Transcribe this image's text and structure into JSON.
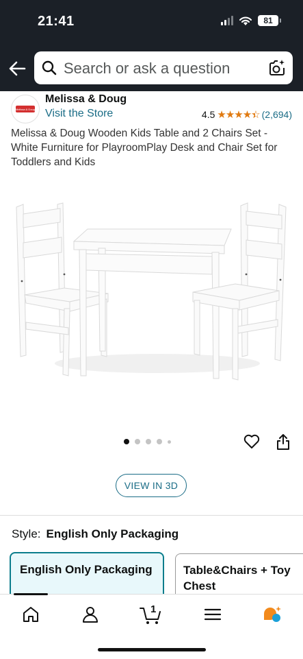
{
  "status_bar": {
    "time": "21:41",
    "battery": "81"
  },
  "search": {
    "placeholder": "Search or ask a question"
  },
  "brand": {
    "name": "Melissa & Doug",
    "visit_store": "Visit the Store",
    "logo_text": "Melissa & Doug"
  },
  "rating": {
    "value": "4.5",
    "stars": "★★★★★",
    "count": "(2,694)"
  },
  "product": {
    "title": "Melissa & Doug Wooden Kids Table and 2 Chairs Set - White Furniture for PlayroomPlay Desk and Chair Set for Toddlers and Kids",
    "image_count": 5,
    "active_image": 1
  },
  "view3d": {
    "label": "VIEW IN 3D"
  },
  "style": {
    "label": "Style:",
    "selected": "English Only Packaging",
    "options": [
      "English Only Packaging",
      "Table&Chairs + Toy Chest"
    ]
  },
  "bottom_nav": {
    "cart_count": "1",
    "items": [
      "home",
      "account",
      "cart",
      "menu",
      "rufus"
    ]
  },
  "colors": {
    "header_bg": "#1b2027",
    "link": "#1a6c86",
    "star": "#e07a10",
    "selected_border": "#0a7d8c"
  }
}
